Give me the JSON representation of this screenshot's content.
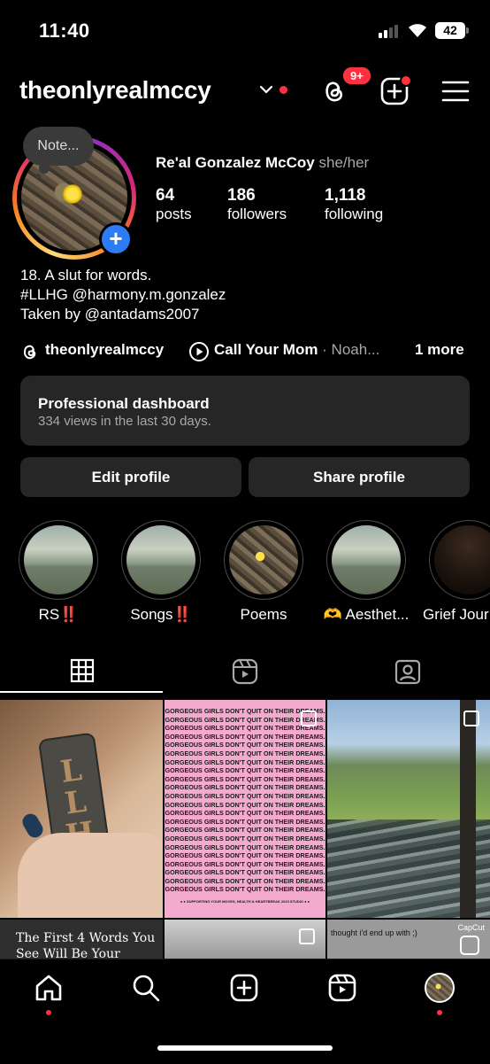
{
  "status": {
    "time": "11:40",
    "battery": "42"
  },
  "header": {
    "username": "theonlyrealmccy",
    "threads_badge": "9+"
  },
  "profile": {
    "note": "Note...",
    "full_name": "Re'al Gonzalez McCoy",
    "pronouns": "she/her",
    "stats": [
      {
        "value": "64",
        "label": "posts"
      },
      {
        "value": "186",
        "label": "followers"
      },
      {
        "value": "1,118",
        "label": "following"
      }
    ],
    "bio": [
      "18. A slut for words.",
      "#LLHG @harmony.m.gonzalez",
      "Taken by @antadams2007"
    ],
    "links": {
      "threads": "theonlyrealmccy",
      "song": "Call Your Mom",
      "artist": " · Noah...",
      "more": "1 more"
    }
  },
  "dashboard": {
    "title": "Professional dashboard",
    "subtitle": "334 views in the last 30 days."
  },
  "buttons": {
    "edit": "Edit profile",
    "share": "Share profile"
  },
  "highlights": [
    {
      "label": "RS‼️"
    },
    {
      "label": "Songs‼️"
    },
    {
      "label": "Poems"
    },
    {
      "label": "🫶 Aesthet..."
    },
    {
      "label": "Grief Jour"
    }
  ],
  "grid": {
    "poster_text": "GORGEOUS GIRLS DON'T QUIT ON THEIR DREAMS.",
    "poster_footer": "● ● SUPPORTING YOUR MOVES, HEALTH & HEARTBREAK 2023 STUDIO ● ●",
    "keychain_text": "LLHG",
    "post4_text": "The First 4 Words You See Will Be Your",
    "post6_text": "thought i'd end up with ;)",
    "post6_capcut": "CapCut"
  }
}
